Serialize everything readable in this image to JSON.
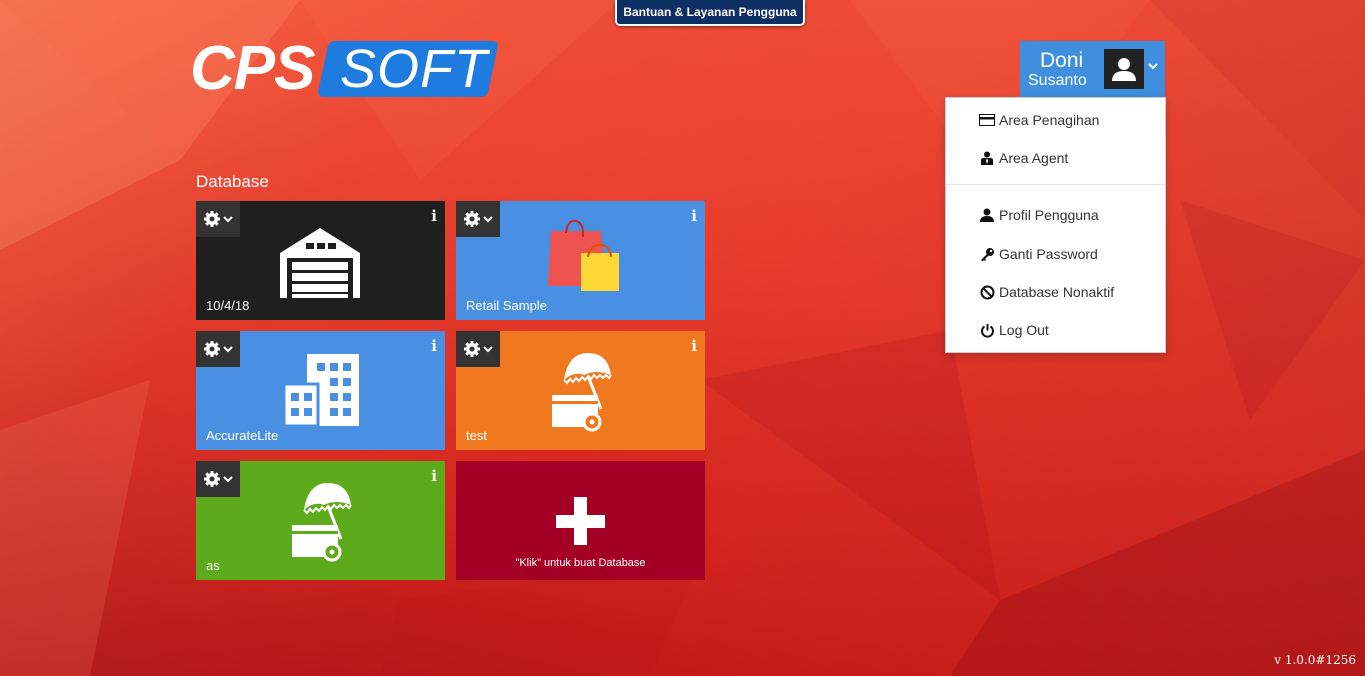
{
  "help_tab": "Bantuan & Layanan Pengguna",
  "logo": {
    "part1": "CPS",
    "part2": "SOFT"
  },
  "user": {
    "first_name": "Doni",
    "last_name": "Susanto"
  },
  "menu": {
    "items": [
      {
        "label": "Area Penagihan",
        "icon": "credit-card-icon"
      },
      {
        "label": "Area Agent",
        "icon": "agent-icon"
      },
      {
        "label": "Profil Pengguna",
        "icon": "user-icon"
      },
      {
        "label": "Ganti Password",
        "icon": "key-icon"
      },
      {
        "label": "Database Nonaktif",
        "icon": "ban-icon"
      },
      {
        "label": "Log Out",
        "icon": "power-icon"
      }
    ]
  },
  "section_title": "Database",
  "tiles": [
    {
      "label": "10/4/18",
      "color": "#1f1f1f",
      "icon": "warehouse-icon"
    },
    {
      "label": "Retail Sample",
      "color": "#4a90e2",
      "icon": "shopping-bags-icon"
    },
    {
      "label": "AccurateLite",
      "color": "#4a90e2",
      "icon": "buildings-icon"
    },
    {
      "label": "test",
      "color": "#f0781e",
      "icon": "umbrella-cart-icon"
    },
    {
      "label": "as",
      "color": "#5daa1a",
      "icon": "umbrella-cart-icon"
    }
  ],
  "add_tile": {
    "label": "\"Klik\" untuk buat Database",
    "color": "#a40026"
  },
  "version": "v 1.0.0#1256"
}
